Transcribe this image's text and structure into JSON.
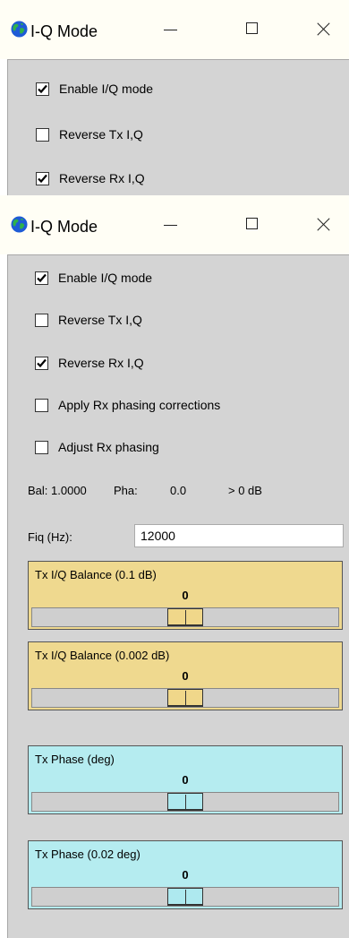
{
  "window_top": {
    "title": "I-Q Mode",
    "checkboxes": [
      {
        "label": "Enable I/Q mode",
        "checked": true
      },
      {
        "label": "Reverse Tx I,Q",
        "checked": false
      },
      {
        "label": "Reverse Rx I,Q",
        "checked": true
      }
    ]
  },
  "window_main": {
    "title": "I-Q Mode",
    "checkboxes": [
      {
        "label": "Enable I/Q mode",
        "checked": true
      },
      {
        "label": "Reverse Tx I,Q",
        "checked": false
      },
      {
        "label": "Reverse Rx I,Q",
        "checked": true
      },
      {
        "label": "Apply Rx phasing corrections",
        "checked": false
      },
      {
        "label": "Adjust Rx phasing",
        "checked": false
      }
    ],
    "status": {
      "bal": "Bal: 1.0000",
      "pha_label": "Pha:",
      "pha_value": "0.0",
      "db": "> 0 dB"
    },
    "fiq": {
      "label": "Fiq (Hz):",
      "value": "12000"
    },
    "sliders": [
      {
        "title": "Tx I/Q Balance (0.1 dB)",
        "value": "0",
        "color": "#efd98f"
      },
      {
        "title": "Tx I/Q Balance (0.002 dB)",
        "value": "0",
        "color": "#efd98f"
      },
      {
        "title": "Tx Phase (deg)",
        "value": "0",
        "color": "#b5ecf0"
      },
      {
        "title": "Tx Phase (0.02 deg)",
        "value": "0",
        "color": "#b5ecf0"
      }
    ]
  },
  "icons": {
    "app": "globe-icon",
    "minimize": "minimize-icon",
    "maximize": "maximize-icon",
    "close": "close-icon",
    "check": "checkmark-icon"
  }
}
